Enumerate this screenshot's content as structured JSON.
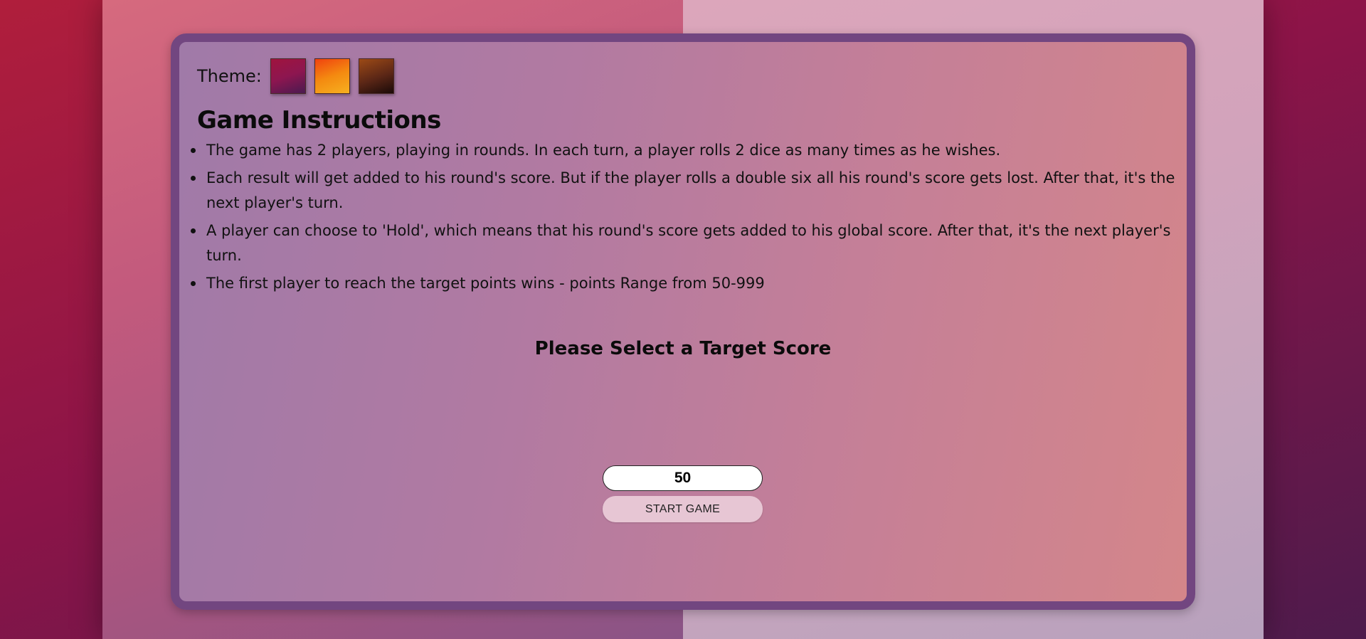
{
  "theme": {
    "label": "Theme:",
    "swatches": [
      {
        "name": "crimson-purple",
        "colors": [
          "#a0143e",
          "#4a1a50"
        ]
      },
      {
        "name": "orange-yellow",
        "colors": [
          "#f0420f",
          "#f6b020"
        ]
      },
      {
        "name": "brown-black",
        "colors": [
          "#9c4a16",
          "#1a0a08"
        ]
      }
    ]
  },
  "instructions": {
    "title": "Game Instructions",
    "items": [
      "The game has 2 players, playing in rounds. In each turn, a player rolls 2 dice as many times as he wishes.",
      "Each result will get added to his round's score. But if the player rolls a double six all his round's score gets lost. After that, it's the next player's turn.",
      "A player can choose to 'Hold', which means that his round's score gets added to his global score. After that, it's the next player's turn.",
      "The first player to reach the target points wins - points Range from 50-999"
    ]
  },
  "target": {
    "title": "Please Select a Target Score",
    "input_value": "50",
    "start_label": "START GAME"
  },
  "colors": {
    "card_border": "#724680",
    "start_button": "#e7c6d4"
  }
}
